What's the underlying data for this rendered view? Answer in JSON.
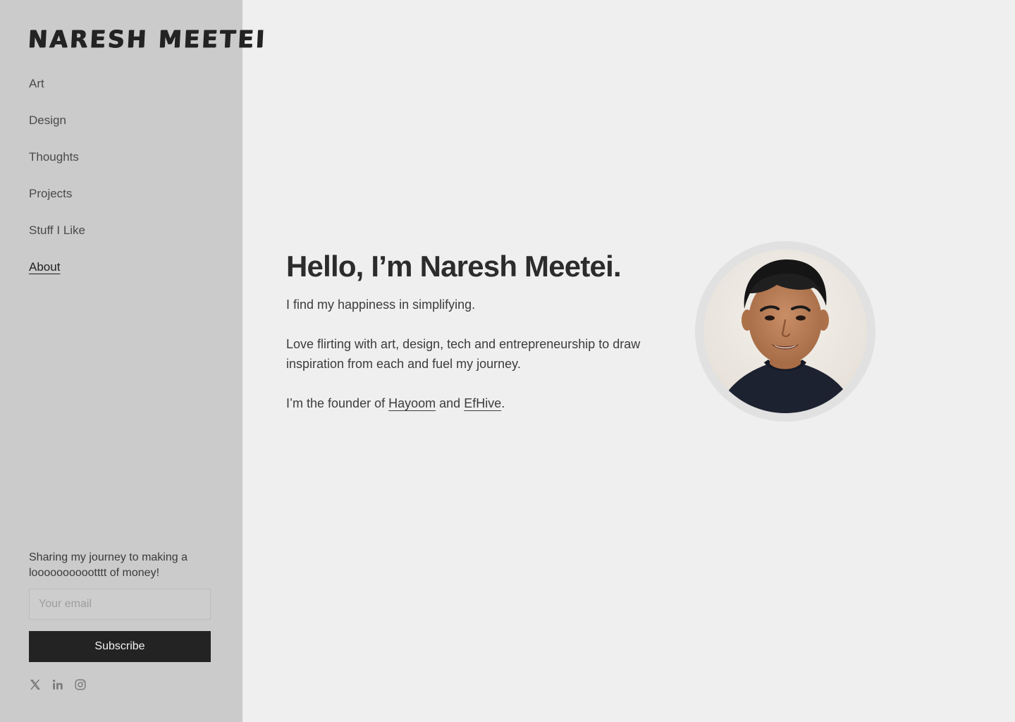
{
  "sidebar": {
    "logo_text": "NARESH MEETEI",
    "nav": [
      {
        "label": "Art"
      },
      {
        "label": "Design"
      },
      {
        "label": "Thoughts"
      },
      {
        "label": "Projects"
      },
      {
        "label": "Stuff I Like"
      },
      {
        "label": "About",
        "active": true
      }
    ],
    "subscribe": {
      "text": "Sharing my journey to making a looooooooootttt of money!",
      "email_placeholder": "Your email",
      "button_label": "Subscribe"
    },
    "socials": [
      {
        "icon": "x-icon"
      },
      {
        "icon": "linkedin-icon"
      },
      {
        "icon": "instagram-icon"
      }
    ]
  },
  "hero": {
    "title": "Hello, I’m Naresh Meetei.",
    "intro": "I find my happiness in simplifying.",
    "body": "Love flirting with art, design, tech and entrepreneurship to draw inspiration from each and fuel my journey.",
    "founder_prefix": "I’m the founder of",
    "link1": "Hayoom",
    "and": "and",
    "link2": "EfHive",
    "period": "."
  },
  "colors": {
    "sidebar_bg": "#cbcbcb",
    "page_bg": "#efefef",
    "button_bg": "#232323"
  }
}
